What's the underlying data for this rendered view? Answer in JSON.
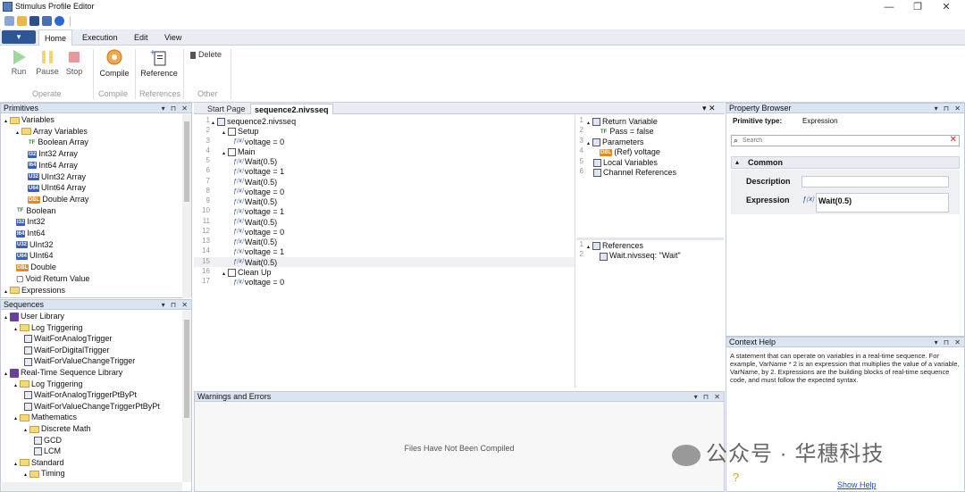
{
  "app": {
    "title": "Stimulus Profile Editor"
  },
  "window_controls": {
    "minimize": "—",
    "restore": "❐",
    "close": "✕"
  },
  "ribbon_tabs": {
    "file": "▾",
    "home": "Home",
    "execution": "Execution",
    "edit": "Edit",
    "view": "View"
  },
  "ribbon": {
    "run": "Run",
    "pause": "Pause",
    "stop": "Stop",
    "compile": "Compile",
    "reference": "Reference",
    "delete": "Delete",
    "group_operate": "Operate",
    "group_compile": "Compile",
    "group_references": "References",
    "group_other": "Other"
  },
  "primitives": {
    "title": "Primitives",
    "items": [
      {
        "label": "Variables",
        "badge": "",
        "indent": 0,
        "arrow": "◢"
      },
      {
        "label": "Array Variables",
        "badge": "",
        "indent": 1,
        "arrow": "◢"
      },
      {
        "label": "Boolean Array",
        "badge": "TF",
        "indent": 2,
        "arrow": ""
      },
      {
        "label": "Int32 Array",
        "badge": "I32",
        "indent": 2,
        "arrow": ""
      },
      {
        "label": "Int64 Array",
        "badge": "I64",
        "indent": 2,
        "arrow": ""
      },
      {
        "label": "UInt32 Array",
        "badge": "U32",
        "indent": 2,
        "arrow": ""
      },
      {
        "label": "UInt64 Array",
        "badge": "U64",
        "indent": 2,
        "arrow": ""
      },
      {
        "label": "Double Array",
        "badge": "DBL",
        "indent": 2,
        "arrow": ""
      },
      {
        "label": "Boolean",
        "badge": "TF",
        "indent": 1,
        "arrow": ""
      },
      {
        "label": "Int32",
        "badge": "I32",
        "indent": 1,
        "arrow": ""
      },
      {
        "label": "Int64",
        "badge": "I64",
        "indent": 1,
        "arrow": ""
      },
      {
        "label": "UInt32",
        "badge": "U32",
        "indent": 1,
        "arrow": ""
      },
      {
        "label": "UInt64",
        "badge": "U64",
        "indent": 1,
        "arrow": ""
      },
      {
        "label": "Double",
        "badge": "DBL",
        "indent": 1,
        "arrow": ""
      },
      {
        "label": "Void Return Value",
        "badge": "▢",
        "indent": 1,
        "arrow": ""
      },
      {
        "label": "Expressions",
        "badge": "",
        "indent": 0,
        "arrow": "◢"
      }
    ]
  },
  "sequences": {
    "title": "Sequences",
    "items": [
      {
        "label": "User Library",
        "type": "lib",
        "indent": 0
      },
      {
        "label": "Log Triggering",
        "type": "folder",
        "indent": 1
      },
      {
        "label": "WaitForAnalogTrigger",
        "type": "seq",
        "indent": 2
      },
      {
        "label": "WaitForDigitalTrigger",
        "type": "seq",
        "indent": 2
      },
      {
        "label": "WaitForValueChangeTrigger",
        "type": "seq",
        "indent": 2
      },
      {
        "label": "Real-Time Sequence Library",
        "type": "lib",
        "indent": 0
      },
      {
        "label": "Log Triggering",
        "type": "folder",
        "indent": 1
      },
      {
        "label": "WaitForAnalogTriggerPtByPt",
        "type": "seq",
        "indent": 2
      },
      {
        "label": "WaitForValueChangeTriggerPtByPt",
        "type": "seq",
        "indent": 2
      },
      {
        "label": "Mathematics",
        "type": "folder",
        "indent": 1
      },
      {
        "label": "Discrete Math",
        "type": "folder",
        "indent": 2
      },
      {
        "label": "GCD",
        "type": "seq",
        "indent": 3
      },
      {
        "label": "LCM",
        "type": "seq",
        "indent": 3
      },
      {
        "label": "Standard",
        "type": "folder",
        "indent": 1
      },
      {
        "label": "Timing",
        "type": "folder",
        "indent": 2
      }
    ]
  },
  "doc_tabs": {
    "start": "Start Page",
    "active": "sequence2.nivsseq"
  },
  "code": [
    {
      "n": "1",
      "text": "sequence2.nivsseq",
      "kind": "seq",
      "indent": 0
    },
    {
      "n": "2",
      "text": "Setup",
      "kind": "block",
      "indent": 1
    },
    {
      "n": "3",
      "text": "voltage = 0",
      "kind": "expr",
      "indent": 2
    },
    {
      "n": "4",
      "text": "Main",
      "kind": "block",
      "indent": 1
    },
    {
      "n": "5",
      "text": "Wait(0.5)",
      "kind": "expr",
      "indent": 2
    },
    {
      "n": "6",
      "text": "voltage = 1",
      "kind": "expr",
      "indent": 2
    },
    {
      "n": "7",
      "text": "Wait(0.5)",
      "kind": "expr",
      "indent": 2
    },
    {
      "n": "8",
      "text": "voltage = 0",
      "kind": "expr",
      "indent": 2
    },
    {
      "n": "9",
      "text": "Wait(0.5)",
      "kind": "expr",
      "indent": 2
    },
    {
      "n": "10",
      "text": "voltage = 1",
      "kind": "expr",
      "indent": 2
    },
    {
      "n": "11",
      "text": "Wait(0.5)",
      "kind": "expr",
      "indent": 2
    },
    {
      "n": "12",
      "text": "voltage = 0",
      "kind": "expr",
      "indent": 2
    },
    {
      "n": "13",
      "text": "Wait(0.5)",
      "kind": "expr",
      "indent": 2
    },
    {
      "n": "14",
      "text": "voltage = 1",
      "kind": "expr",
      "indent": 2
    },
    {
      "n": "15",
      "text": "Wait(0.5)",
      "kind": "expr",
      "indent": 2
    },
    {
      "n": "16",
      "text": "Clean Up",
      "kind": "block",
      "indent": 1
    },
    {
      "n": "17",
      "text": "voltage = 0",
      "kind": "expr",
      "indent": 2
    }
  ],
  "vars": [
    {
      "n": "1",
      "text": "Return Variable",
      "indent": 0
    },
    {
      "n": "2",
      "text": "Pass = false",
      "indent": 1,
      "badge": "TF"
    },
    {
      "n": "3",
      "text": "Parameters",
      "indent": 0
    },
    {
      "n": "4",
      "text": "(Ref) voltage",
      "indent": 1,
      "badge": "DBL"
    },
    {
      "n": "5",
      "text": "Local Variables",
      "indent": 0
    },
    {
      "n": "6",
      "text": "Channel References",
      "indent": 0
    }
  ],
  "refs": [
    {
      "n": "1",
      "text": "References",
      "indent": 0
    },
    {
      "n": "2",
      "text": "Wait.nivsseq: \"Wait\"",
      "indent": 1
    }
  ],
  "warnings": {
    "title": "Warnings and Errors",
    "message": "Files Have Not Been Compiled"
  },
  "property": {
    "title": "Property Browser",
    "type_label": "Primitive type:",
    "type_value": "Expression",
    "search_placeholder": "Search",
    "section": "Common",
    "desc_label": "Description",
    "desc_value": "",
    "expr_label": "Expression",
    "expr_value": "Wait(0.5)"
  },
  "context": {
    "title": "Context Help",
    "text": "A statement that can operate on variables in a real-time sequence. For example, VarName * 2 is an expression that multiplies the value of a variable, VarName, by 2. Expressions are the building blocks of real-time sequence code, and must follow the expected syntax.",
    "link": "Show Help"
  },
  "watermark": "公众号 · 华穗科技",
  "panel_controls": "▾ ⊓ ✕"
}
